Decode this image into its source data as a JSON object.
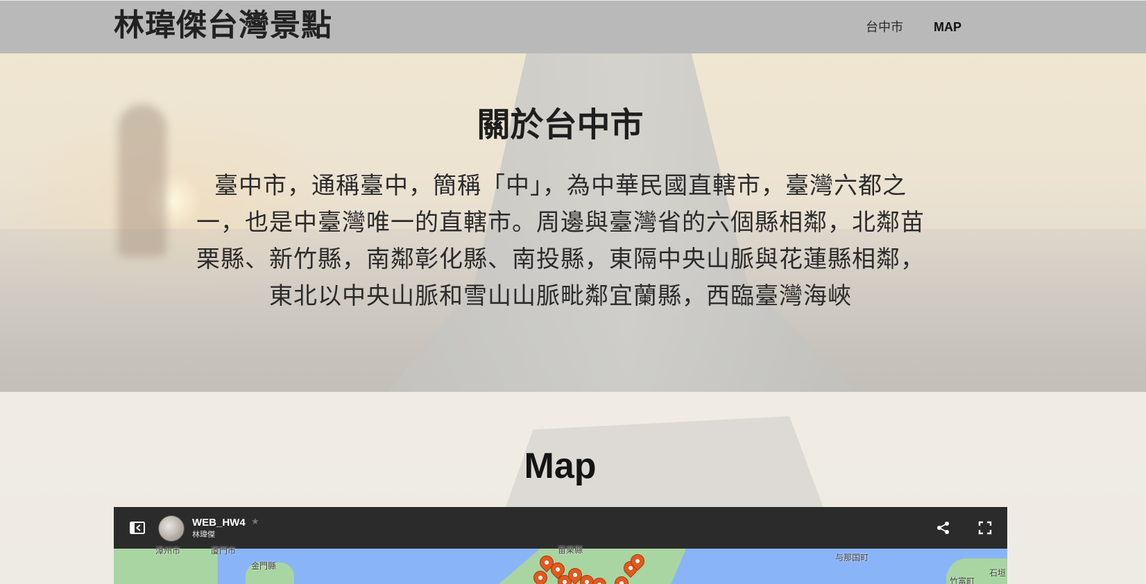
{
  "navbar": {
    "brand": "林瑋傑台灣景點",
    "links": [
      {
        "label": "台中市"
      },
      {
        "label": "MAP"
      }
    ]
  },
  "about": {
    "title": "關於台中市",
    "text": "臺中市，通稱臺中，簡稱「中」，為中華民國直轄市，臺灣六都之一，也是中臺灣唯一的直轄市。周邊與臺灣省的六個縣相鄰，北鄰苗栗縣、新竹縣，南鄰彰化縣、南投縣，東隔中央山脈與花蓮縣相鄰，東北以中央山脈和雪山山脈毗鄰宜蘭縣，西臨臺灣海峽"
  },
  "map_section": {
    "title": "Map",
    "embed": {
      "map_name": "WEB_HW4",
      "author": "林瑋傑",
      "place_labels": {
        "xiamen_region": "廈門市",
        "zhangzhou": "漳州市",
        "kinmen": "金門縣",
        "miaoli": "苗栗縣",
        "yonaguni": "与那国町",
        "taketomi": "竹富町",
        "ishigaki": "石垣"
      }
    }
  },
  "icons": {
    "panel": "side-panel-icon",
    "star": "star-icon",
    "share": "share-icon",
    "fullscreen": "fullscreen-icon",
    "marker": "map-marker-icon"
  },
  "colors": {
    "navbar_bg": "#b9b9b9",
    "map_header_bg": "#2b2b2b",
    "sea": "#8ab4f8",
    "land": "#a8d5a1",
    "marker": "#e05a1f"
  }
}
